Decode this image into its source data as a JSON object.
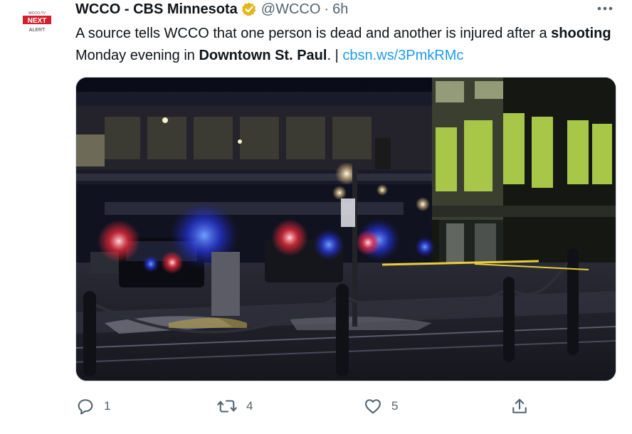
{
  "tweet": {
    "avatar_icon": "wcco-next-alert-logo",
    "author_name": "WCCO - CBS Minnesota",
    "verified_icon": "verified-badge-icon",
    "handle": "@WCCO",
    "separator": "·",
    "time": "6h",
    "text_parts": {
      "p1": "A source tells WCCO that one person is dead and another is injured after a ",
      "bold1": "shooting",
      "p2": " Monday evening in ",
      "bold2": "Downtown St. Paul",
      "p3": ". | ",
      "link": "cbsn.ws/3PmkRMc"
    },
    "media_description_icon": "night-street-police-scene-photo"
  },
  "actions": {
    "reply": {
      "icon": "reply-icon",
      "count": "1"
    },
    "retweet": {
      "icon": "retweet-icon",
      "count": "4"
    },
    "like": {
      "icon": "like-icon",
      "count": "5"
    },
    "share": {
      "icon": "share-icon"
    }
  },
  "colors": {
    "accent": "#1d9bf0",
    "verified": "#e2b719",
    "secondary_text": "#536471"
  }
}
